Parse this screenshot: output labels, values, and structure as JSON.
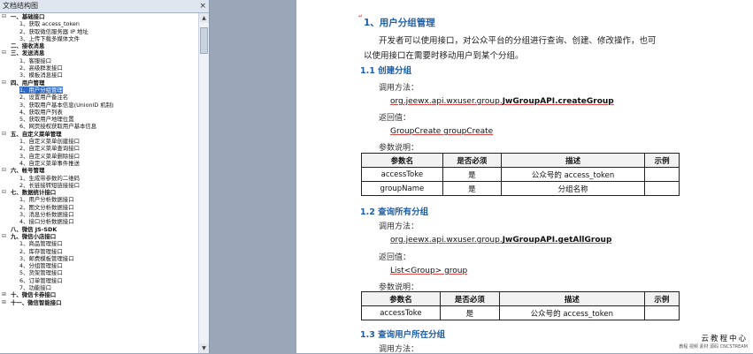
{
  "pane": {
    "title": "文档结构图",
    "close_glyph": "×",
    "items": [
      {
        "text": "一、基础接口",
        "level": 0,
        "expander": "⊟"
      },
      {
        "text": "1、获取 access_token",
        "level": 1
      },
      {
        "text": "2、获取微信服务器 IP 地址",
        "level": 1
      },
      {
        "text": "3、上传下载多媒体文件",
        "level": 1
      },
      {
        "text": "二、接收消息",
        "level": 0,
        "expander": ""
      },
      {
        "text": "三、发送消息",
        "level": 0,
        "expander": "⊟"
      },
      {
        "text": "1、客服接口",
        "level": 1
      },
      {
        "text": "2、高级群发接口",
        "level": 1
      },
      {
        "text": "3、模板消息接口",
        "level": 1
      },
      {
        "text": "四、用户管理",
        "level": 0,
        "expander": "⊟"
      },
      {
        "text": "1、用户分组管理",
        "level": 1,
        "selected": true
      },
      {
        "text": "2、设置用户备注名",
        "level": 1
      },
      {
        "text": "3、获取用户基本信息(UnionID 机制)",
        "level": 1
      },
      {
        "text": "4、获取用户列表",
        "level": 1
      },
      {
        "text": "5、获取用户地理位置",
        "level": 1
      },
      {
        "text": "6、网页授权获取用户基本信息",
        "level": 1
      },
      {
        "text": "五、自定义菜单管理",
        "level": 0,
        "expander": "⊟"
      },
      {
        "text": "1、自定义菜单创建接口",
        "level": 1
      },
      {
        "text": "2、自定义菜单查询接口",
        "level": 1
      },
      {
        "text": "3、自定义菜单删除接口",
        "level": 1
      },
      {
        "text": "4、自定义菜单事件推送",
        "level": 1
      },
      {
        "text": "六、帐号管理",
        "level": 0,
        "expander": "⊟"
      },
      {
        "text": "1、生成带参数的二维码",
        "level": 1
      },
      {
        "text": "2、长链接转短链接接口",
        "level": 1
      },
      {
        "text": "七、数据统计接口",
        "level": 0,
        "expander": "⊟"
      },
      {
        "text": "1、用户分析数据接口",
        "level": 1
      },
      {
        "text": "2、图文分析数据接口",
        "level": 1
      },
      {
        "text": "3、消息分析数据接口",
        "level": 1
      },
      {
        "text": "4、接口分析数据接口",
        "level": 1
      },
      {
        "text": "八、微信 JS-SDK",
        "level": 0,
        "expander": ""
      },
      {
        "text": "九、微信小店接口",
        "level": 0,
        "expander": "⊟"
      },
      {
        "text": "1、商品管理接口",
        "level": 1
      },
      {
        "text": "2、库存管理接口",
        "level": 1
      },
      {
        "text": "3、邮费模板管理接口",
        "level": 1
      },
      {
        "text": "4、分组管理接口",
        "level": 1
      },
      {
        "text": "5、货架管理接口",
        "level": 1
      },
      {
        "text": "6、订单管理接口",
        "level": 1
      },
      {
        "text": "7、功能接口",
        "level": 1
      },
      {
        "text": "十、微信卡券接口",
        "level": 0,
        "expander": "⊞"
      },
      {
        "text": "十一、微信智能接口",
        "level": 0,
        "expander": "⊞"
      }
    ]
  },
  "doc": {
    "h1": "1、用户分组管理",
    "intro1": "开发者可以使用接口，对公众平台的分组进行查询、创建、修改操作，也可",
    "intro2": "以使用接口在需要时移动用户到某个分组。",
    "calling_label": "调用方法：",
    "return_label": "返回值：",
    "params_label": "参数说明：",
    "para_mark": "↵",
    "s1": {
      "title": "1.1 创建分组",
      "method_prefix": "org.jeewx.api.wxuser.group.",
      "method_bold": "JwGroupAPI.createGroup",
      "return_value": "GroupCreate groupCreate",
      "table": {
        "headers": [
          "参数名",
          "是否必须",
          "描述",
          "示例"
        ],
        "rows": [
          [
            "accessToke",
            "是",
            "公众号的 access_token",
            ""
          ],
          [
            "groupName",
            "是",
            "分组名称",
            ""
          ]
        ]
      }
    },
    "s2": {
      "title": "1.2 查询所有分组",
      "method_prefix": "org.jeewx.api.wxuser.group.",
      "method_bold": "JwGroupAPI.getAllGroup",
      "return_value": "List<Group>    group",
      "table": {
        "headers": [
          "参数名",
          "是否必须",
          "描述",
          "示例"
        ],
        "rows": [
          [
            "accessToke",
            "是",
            "公众号的 access_token",
            ""
          ]
        ]
      }
    },
    "s3": {
      "title": "1.3 查询用户所在分组"
    }
  },
  "watermark": {
    "name": "云教程中心",
    "sub": "教程 视频 素材 源码 CNCSTREAM"
  }
}
